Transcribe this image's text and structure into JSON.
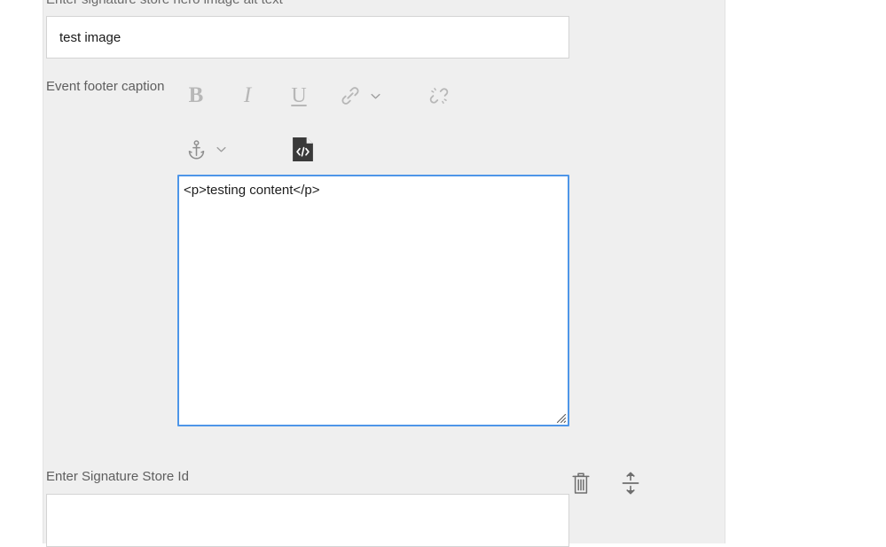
{
  "panel": {
    "background_color": "#efefef",
    "border_color": "#e3e3e3"
  },
  "alt_text_field": {
    "label": "Enter signature store hero image alt text",
    "value": "test image",
    "placeholder": ""
  },
  "caption_field": {
    "label": "Event footer caption",
    "toolbar": {
      "row1": [
        {
          "name": "bold-button",
          "glyph": "B",
          "title": "Bold"
        },
        {
          "name": "italic-button",
          "glyph": "I",
          "title": "Italic"
        },
        {
          "name": "underline-button",
          "glyph": "U",
          "title": "Underline"
        },
        {
          "name": "link-button",
          "glyph": "link-icon",
          "title": "Link"
        },
        {
          "name": "link-dropdown",
          "glyph": "chevron-down-icon",
          "title": "Link options"
        },
        {
          "name": "unlink-button",
          "glyph": "unlink-icon",
          "title": "Unlink"
        }
      ],
      "row2": [
        {
          "name": "anchor-button",
          "glyph": "anchor-icon",
          "title": "Anchor"
        },
        {
          "name": "anchor-dropdown",
          "glyph": "chevron-down-icon",
          "title": "Anchor options"
        },
        {
          "name": "source-code-button",
          "glyph": "code-file-icon",
          "title": "Source code",
          "active": true
        }
      ]
    },
    "editor": {
      "value": "<p>testing content</p>\n",
      "focused": true,
      "focus_border_color": "#4e96e8"
    }
  },
  "store_id_field": {
    "label": "Enter Signature Store Id",
    "value": "",
    "placeholder": ""
  },
  "row_actions": [
    {
      "name": "delete-button",
      "icon": "trash-icon",
      "title": "Delete"
    },
    {
      "name": "reorder-button",
      "icon": "move-vertical-icon",
      "title": "Move"
    }
  ],
  "colors": {
    "label_text": "#5e5e5e",
    "toolbar_icon": "#b7b7b7",
    "action_icon": "#6e6e6e",
    "code_icon_dark": "#3a3a3a",
    "input_border": "#d4d4d4",
    "focus_blue": "#4e96e8"
  }
}
